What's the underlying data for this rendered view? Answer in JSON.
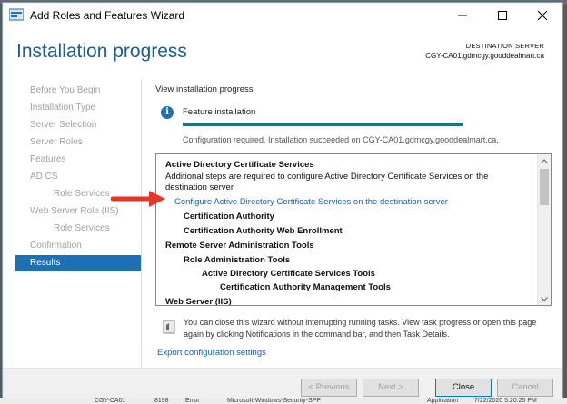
{
  "window": {
    "title": "Add Roles and Features Wizard",
    "icon": "server-manager-icon"
  },
  "header": {
    "title": "Installation progress",
    "destination_label": "DESTINATION SERVER",
    "destination_server": "CGY-CA01.gdmcgy.gooddealmart.ca"
  },
  "nav": {
    "items": [
      {
        "label": "Before You Begin"
      },
      {
        "label": "Installation Type"
      },
      {
        "label": "Server Selection"
      },
      {
        "label": "Server Roles"
      },
      {
        "label": "Features"
      },
      {
        "label": "AD CS"
      },
      {
        "label": "Role Services"
      },
      {
        "label": "Web Server Role (IIS)"
      },
      {
        "label": "Role Services"
      },
      {
        "label": "Confirmation"
      },
      {
        "label": "Results"
      }
    ],
    "active": "Results"
  },
  "progress": {
    "view_label": "View installation progress",
    "feature_label": "Feature installation",
    "percent": 100,
    "status": "Configuration required. Installation succeeded on CGY-CA01.gdmcgy.gooddealmart.ca."
  },
  "results_list": {
    "lines": [
      {
        "text": "Active Directory Certificate Services"
      },
      {
        "text": "Additional steps are required to configure Active Directory Certificate Services on the"
      },
      {
        "text": "destination server"
      },
      {
        "text": "Configure Active Directory Certificate Services on the destination server"
      },
      {
        "text": "Certification Authority"
      },
      {
        "text": "Certification Authority Web Enrollment"
      },
      {
        "text": "Remote Server Administration Tools"
      },
      {
        "text": "Role Administration Tools"
      },
      {
        "text": "Active Directory Certificate Services Tools"
      },
      {
        "text": "Certification Authority Management Tools"
      },
      {
        "text": "Web Server (IIS)"
      }
    ]
  },
  "note": {
    "text": "You can close this wizard without interrupting running tasks. View task progress or open this page again by clicking Notifications in the command bar, and then Task Details."
  },
  "export_link": "Export configuration settings",
  "footer": {
    "previous": "< Previous",
    "next": "Next >",
    "close": "Close",
    "cancel": "Cancel"
  },
  "desktop_strip": {
    "items": [
      "CGY-CA01",
      "8198",
      "Error",
      "Microsoft-Windows-Security-SPP",
      "Application",
      "7/22/2020 5:20:25 PM"
    ]
  },
  "colors": {
    "accent": "#1e6fb4",
    "title_blue": "#1d5f90",
    "link": "#1a5fa8",
    "progress": "#1f6e8c",
    "arrow": "#e8352a"
  }
}
